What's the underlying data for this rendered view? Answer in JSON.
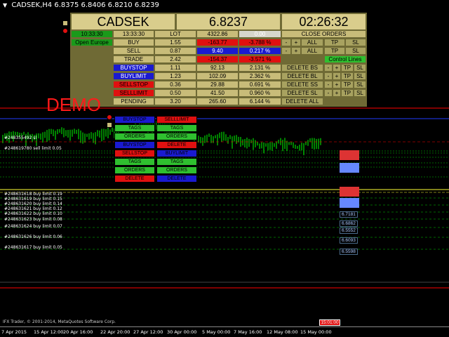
{
  "window": {
    "title": "CADSEK,H4",
    "prices": "6.8375 6.8406 6.8210 6.8239"
  },
  "panel": {
    "symbol": "CADSEK",
    "price": "6.8237",
    "clock": "02:26:32",
    "time_green": "10:33:30",
    "time_gray": "13:33:30",
    "session": "Open Europe",
    "lot_label": "LOT",
    "lot_value": "4322.86",
    "lot_zero": "0.00",
    "close_orders": "CLOSE ORDERS",
    "rows": [
      {
        "name": "BUY",
        "lot": "1.55",
        "v1": "-163.77",
        "v2": "-3.788 %"
      },
      {
        "name": "SELL",
        "lot": "0.87",
        "v1": "9.40",
        "v2": "0.217 %"
      },
      {
        "name": "TRADE",
        "lot": "2.42",
        "v1": "-154.37",
        "v2": "-3.571 %"
      },
      {
        "name": "BUYSTOP",
        "lot": "1.11",
        "v1": "92.13",
        "v2": "2.131 %"
      },
      {
        "name": "BUYLIMIT",
        "lot": "1.23",
        "v1": "102.09",
        "v2": "2.362 %"
      },
      {
        "name": "SELLSTOP",
        "lot": "0.36",
        "v1": "29.88",
        "v2": "0.691 %"
      },
      {
        "name": "SELLLIMIT",
        "lot": "0.50",
        "v1": "41.50",
        "v2": "0.960 %"
      },
      {
        "name": "PENDING",
        "lot": "3.20",
        "v1": "265.60",
        "v2": "6.144 %"
      }
    ],
    "ctrl": {
      "minus": "-",
      "plus": "+",
      "all": "ALL",
      "tp": "TP",
      "sl": "SL"
    },
    "control_lines": "Control Lines",
    "delete_bs": "DELETE BS",
    "delete_bl": "DELETE BL",
    "delete_ss": "DELETE SS",
    "delete_sl": "DELETE SL",
    "delete_all": "DELETE ALL"
  },
  "demo": "DEMO",
  "menu": {
    "row1": [
      "BUYSTOP",
      "SELLLIMIT"
    ],
    "row2": [
      "TAGS",
      "TAGS"
    ],
    "row3": [
      "ORDERS",
      "ORDERS"
    ],
    "row4": [
      "BUYSTOP",
      "DELETE"
    ],
    "row5": [
      "SELLSTOP",
      "BUYLIMIT"
    ],
    "row6": [
      "TAGS",
      "TAGS"
    ],
    "row7": [
      "ORDERS",
      "ORDERS"
    ],
    "row8": [
      "DELETE",
      "DELETE"
    ]
  },
  "left_labels": [
    "#248355492 sl",
    "#248619780 sell limit 0.05",
    "#248631618 buy limit 0.19",
    "#248631619 buy limit 0.15",
    "#248631620 buy limit 0.14",
    "#248631621 buy limit 0.12",
    "#248631622 buy limit 0.10",
    "#248631623 buy limit 0.08",
    "#248631624 buy limit 0.07",
    "#248631626 buy limit 0.06",
    "#248631617 buy limit 0.05"
  ],
  "price_labels": [
    "6.6862",
    "6.6093",
    "6.5598",
    "6.7181",
    "6.5552"
  ],
  "copyright": "IFX Trader, © 2001-2014, MetaQuotes Software Corp.",
  "x_axis": [
    "7 Apr 2015",
    "15 Apr 12:00",
    "20 Apr 16:00",
    "22 Apr 20:00",
    "27 Apr 12:00",
    "30 Apr 00:00",
    "5 May 00:00",
    "7 May 16:00",
    "12 May 08:00",
    "15 May 00:00"
  ],
  "time_tag": "15:01:00",
  "colors": {
    "bg": "#000000",
    "candle": "#00ff00",
    "blue_line": "#1f3bff",
    "red_line": "#ff0000",
    "yellow_line": "#ffff33"
  }
}
